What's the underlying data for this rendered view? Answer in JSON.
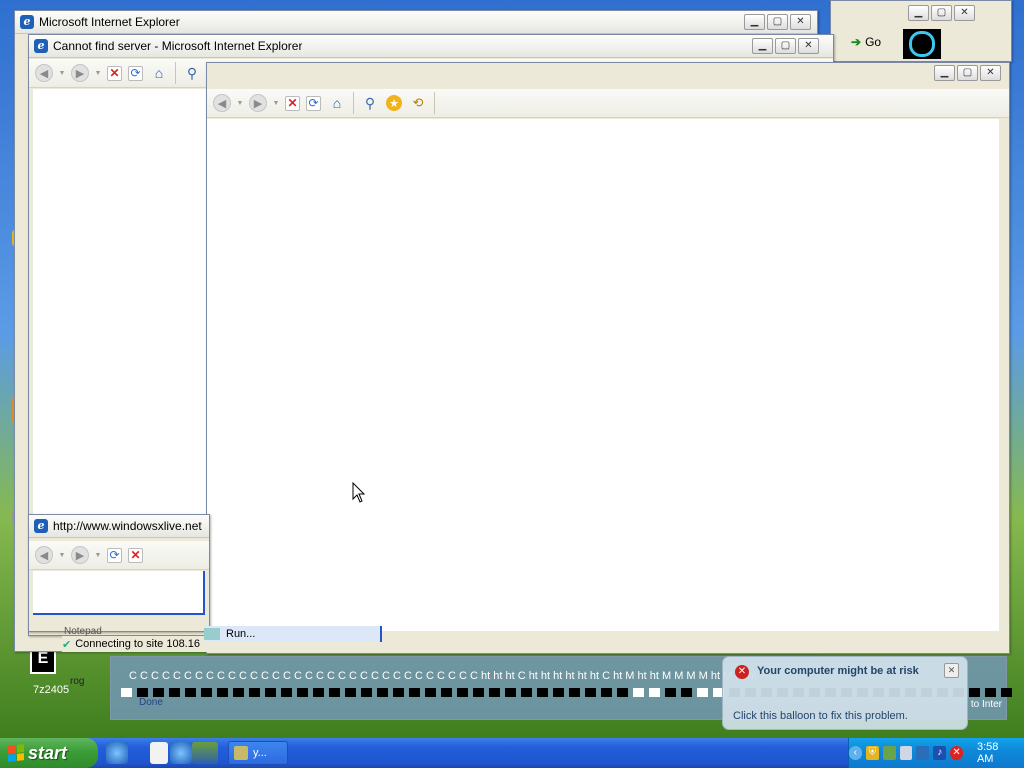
{
  "window_back": {
    "title": "Microsoft Internet Explorer"
  },
  "window_cannot_find": {
    "title": "Cannot find server - Microsoft Internet Explorer"
  },
  "window_small": {
    "title": "http://www.windowsxlive.net"
  },
  "go_window": {
    "go_label": "Go"
  },
  "desktop": {
    "label_7z": "7z2405"
  },
  "under_windows": {
    "notepad": "Notepad",
    "connecting": "Connecting to site 108.16",
    "run": "Run...",
    "done": "Done",
    "prog": "rog"
  },
  "overlay_strip": {
    "tabs": "C  C  C  C  C  C  C  C  C  C  C  C  C  C  C  C  C  C  C  C  C  C  C  C  C  C  C  C  C  C  C  C  ht  ht  ht  C  ht  ht  ht  ht  ht  ht  C  ht  M  ht  ht  M  M  M  M  ht  M  ht  ht",
    "right_partial": "to Inter"
  },
  "balloon": {
    "title": "Your computer might be at risk",
    "text": "Click this balloon to fix this problem."
  },
  "taskbar": {
    "start_label": "start",
    "task_label": "y...",
    "clock": "3:58 AM"
  },
  "colors": {
    "taskbar_blue": "#245edb",
    "start_green": "#3c9e38",
    "tray_blue": "#0f8ad8",
    "balloon_bg": "#d0e0ea"
  },
  "icons": [
    "ie-icon",
    "back-icon",
    "forward-icon",
    "stop-icon",
    "refresh-icon",
    "home-icon",
    "search-icon",
    "favorites-icon",
    "history-icon",
    "minimize-icon",
    "maximize-icon",
    "close-icon",
    "go-arrow-icon",
    "cursor-icon",
    "shield-icon",
    "volume-icon",
    "network-icon"
  ]
}
